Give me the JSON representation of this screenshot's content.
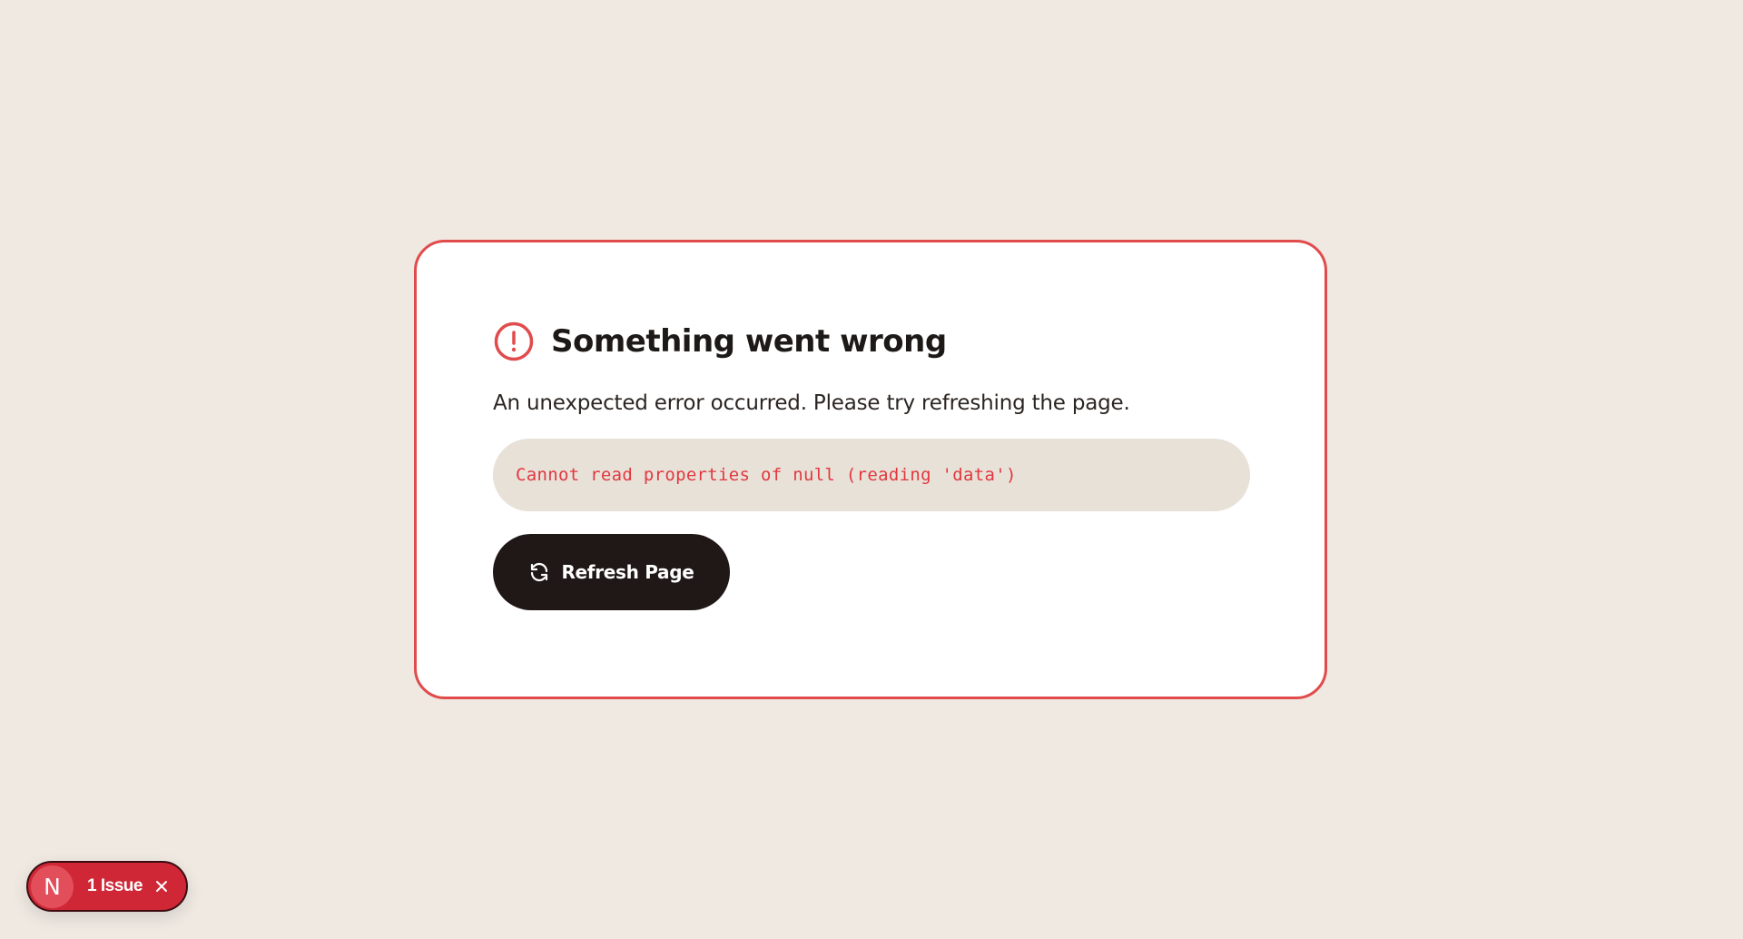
{
  "error_card": {
    "title": "Something went wrong",
    "description": "An unexpected error occurred. Please try refreshing the page.",
    "error_message": "Cannot read properties of null (reading 'data')",
    "refresh_label": "Refresh Page",
    "alert_icon": "alert-circle-icon",
    "refresh_icon": "refresh-icon",
    "accent_color": "#e14b4b"
  },
  "dev_indicator": {
    "badge_letter": "N",
    "issue_label": "1 Issue",
    "close_icon": "close-icon",
    "background_color": "#cf2736"
  }
}
